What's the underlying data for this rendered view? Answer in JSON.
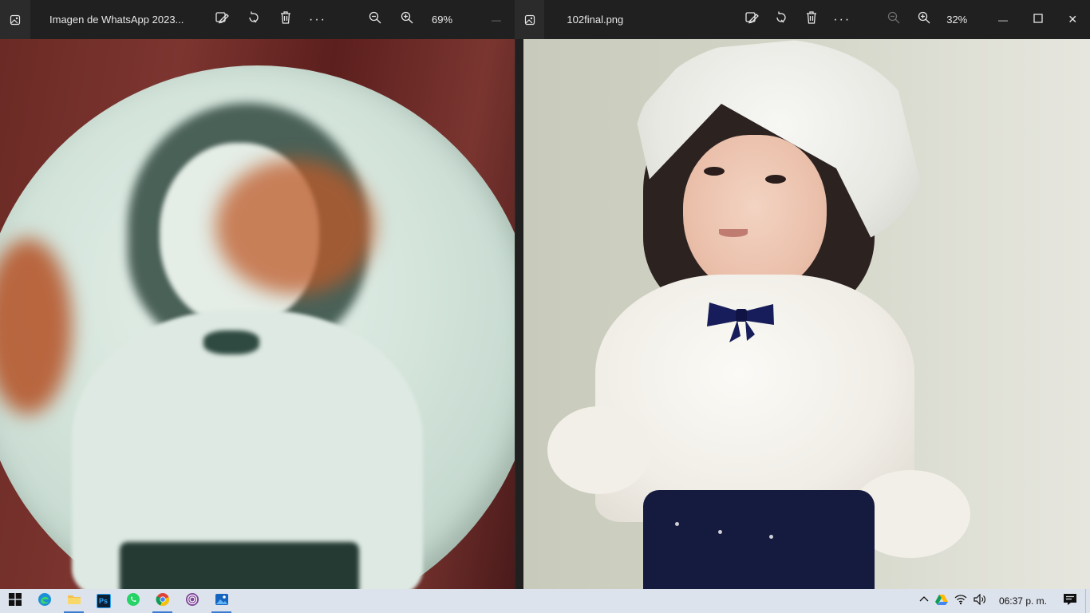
{
  "left_window": {
    "title": "Imagen de WhatsApp 2023...",
    "zoom": "69%",
    "toolbar": {
      "edit_icon": "edit-image-icon",
      "rotate_icon": "rotate-icon",
      "delete_icon": "delete-icon",
      "more_label": "···",
      "zoom_out_icon": "zoom-out-icon",
      "zoom_in_icon": "zoom-in-icon"
    },
    "minimize_label": "—"
  },
  "right_window": {
    "title": "102final.png",
    "zoom": "32%",
    "toolbar": {
      "more_label": "···"
    },
    "window_controls": {
      "minimize": "—",
      "close": "✕"
    }
  },
  "taskbar": {
    "apps": [
      "start-icon",
      "edge-icon",
      "file-explorer-icon",
      "photoshop-icon",
      "whatsapp-icon",
      "chrome-icon",
      "tor-browser-icon",
      "photos-icon"
    ],
    "photoshop_label": "Ps",
    "clock": "06:37 p. m."
  },
  "colors": {
    "titlebar": "#202020",
    "taskbar": "#dde3ec",
    "accent": "#3b7bd4"
  }
}
